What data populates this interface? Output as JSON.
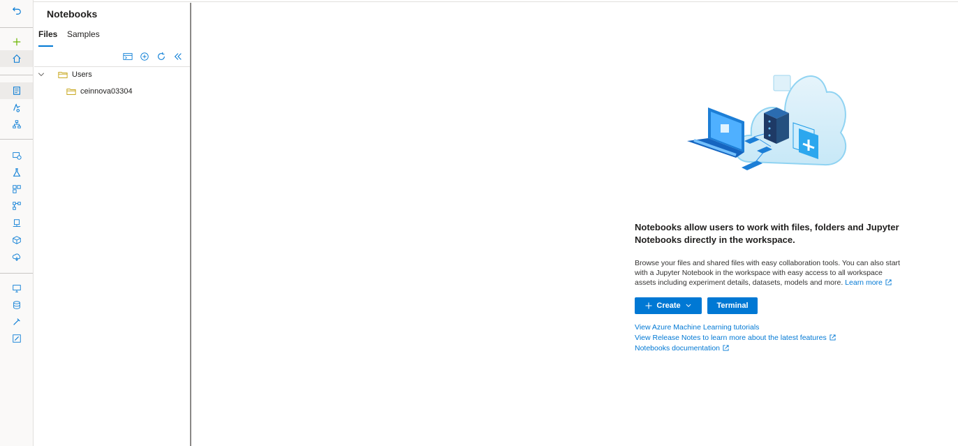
{
  "left_nav": {
    "icons": [
      "undo-icon",
      "plus-icon",
      "home-icon",
      "notebook-icon",
      "automl-icon",
      "designer-icon",
      "data-icon",
      "experiments-icon",
      "pipelines-icon",
      "models-icon",
      "endpoints-icon",
      "components-icon",
      "environments-icon",
      "compute-icon",
      "datastores-icon",
      "data-labeling-icon",
      "linked-services-icon"
    ]
  },
  "panel": {
    "title": "Notebooks",
    "tabs": [
      "Files",
      "Samples"
    ],
    "active_tab": "Files",
    "toolbar": [
      "terminal-icon",
      "add-file-icon",
      "refresh-icon",
      "collapse-panel-icon"
    ],
    "tree": [
      {
        "label": "Users",
        "expanded": true
      },
      {
        "label": "ceinnova03304"
      }
    ]
  },
  "main": {
    "heading": "Notebooks allow users to work with files, folders and Jupyter Notebooks directly in the workspace.",
    "description": "Browse your files and shared files with easy collaboration tools. You can also start with a Jupyter Notebook in the workspace with easy access to all workspace assets including experiment details, datasets, models and more.",
    "learn_more": "Learn more",
    "create_label": "Create",
    "terminal_label": "Terminal",
    "links": [
      "View Azure Machine Learning tutorials",
      "View Release Notes to learn more about the latest features",
      "Notebooks documentation"
    ]
  },
  "colors": {
    "accent": "#0078d4",
    "folder": "#c19c00",
    "nav_bg": "#faf9f8"
  }
}
